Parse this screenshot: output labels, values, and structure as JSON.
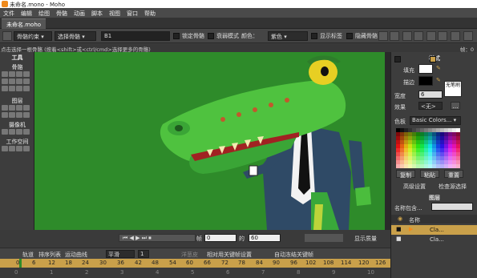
{
  "window": {
    "title": "未命名.mono - Moho"
  },
  "menu": [
    "文件",
    "编辑",
    "绘图",
    "骨骼",
    "动画",
    "脚本",
    "视图",
    "窗口",
    "帮助"
  ],
  "doc_tab": "未命名.moho",
  "tool_options": {
    "bone_bind_label": "骨骼约束",
    "select_bone_label": "选择骨骼",
    "bone_name_value": "B1",
    "lock_bone_label": "锁定骨骼",
    "invisible_label": "衰弱模式",
    "color_label": "颜色：",
    "color_value": "紫色",
    "show_labels_label": "显示标签",
    "hide_bones_label": "隐藏骨骼"
  },
  "hint": {
    "text": "点击选择一根骨骼 (按着<shift>或<ctrl/cmd>选择更多的骨骼)",
    "frame_label": "帧：0"
  },
  "left_panel": {
    "title": "工具",
    "sections": [
      "骨骼",
      "图层",
      "摄像机",
      "工作空间"
    ]
  },
  "style_panel": {
    "title": "样式",
    "fill_label": "填充",
    "stroke_label": "描边",
    "no_brush_label": "无笔刷",
    "width_label": "宽度",
    "width_value": "6",
    "effect_label": "效果",
    "effect_value": "<无>",
    "palette_label": "色板",
    "palette_value": "Basic Colors...",
    "copy_label": "复制",
    "paste_label": "粘贴",
    "reset_label": "重置",
    "advanced_label": "高级设置",
    "check_source_label": "检查源选择"
  },
  "layers_panel": {
    "title": "图层",
    "filter_label": "名称包含...",
    "name_header": "名称",
    "layers": [
      "Cla...",
      "Cla..."
    ]
  },
  "transport": {
    "frame_label": "帧",
    "frame_value": "0",
    "of_label": "的",
    "total_value": "60",
    "quality_label": "显示质量"
  },
  "timeline": {
    "tabs": [
      "轨道",
      "排序列表",
      "运动曲线"
    ],
    "interp_value": "平滑",
    "step_value": "1",
    "ease_label": "洋葱皮",
    "relative_label": "相对用关键帧设置",
    "auto_freeze_label": "自动冻结关键帧",
    "frame_numbers": [
      "0",
      "6",
      "12",
      "18",
      "24",
      "30",
      "36",
      "42",
      "48",
      "54",
      "60",
      "66",
      "72",
      "78",
      "84",
      "90",
      "96",
      "102",
      "108",
      "114",
      "120",
      "126"
    ],
    "bottom_numbers": [
      "0",
      "1",
      "2",
      "3",
      "4",
      "5",
      "6",
      "7",
      "8",
      "9",
      "10"
    ]
  },
  "colors": {
    "accent": "#f08a1c",
    "canvas_bg": "#2e8b2a",
    "timeline_bar": "#c9a04a",
    "panel_bg": "#3d3d3d"
  }
}
